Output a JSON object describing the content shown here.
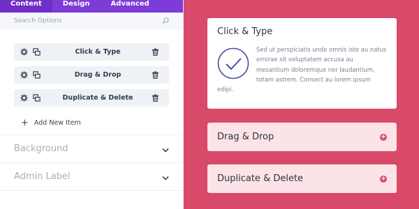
{
  "tabs": [
    "Content",
    "Design",
    "Advanced"
  ],
  "search": {
    "placeholder": "Search Options"
  },
  "items": [
    {
      "label": "Click & Type"
    },
    {
      "label": "Drag & Drop"
    },
    {
      "label": "Duplicate & Delete"
    }
  ],
  "add_item_label": "Add New Item",
  "sections": [
    "Background",
    "Admin Label"
  ],
  "preview": {
    "open": {
      "title": "Click & Type",
      "text": "Sed ut perspiciatis unde omnis iste au natus errorae sit voluptatem accusa au mesantium doloremque ner laudantium, totam astrem. Consect au lorem ipsum",
      "text_tail": "edipi."
    },
    "closed": [
      {
        "title": "Drag & Drop"
      },
      {
        "title": "Duplicate & Delete"
      }
    ]
  },
  "colors": {
    "tabs_bg": "#7d3bd8",
    "preview_bg": "#d8496a",
    "closed_card_bg": "#fbe3e7",
    "check_icon": "#4b4fa6"
  },
  "icons": [
    "search-icon",
    "gear-icon",
    "duplicate-icon",
    "trash-icon",
    "plus-icon",
    "chevron-down-icon",
    "check-circle-icon",
    "plus-circle-icon"
  ]
}
